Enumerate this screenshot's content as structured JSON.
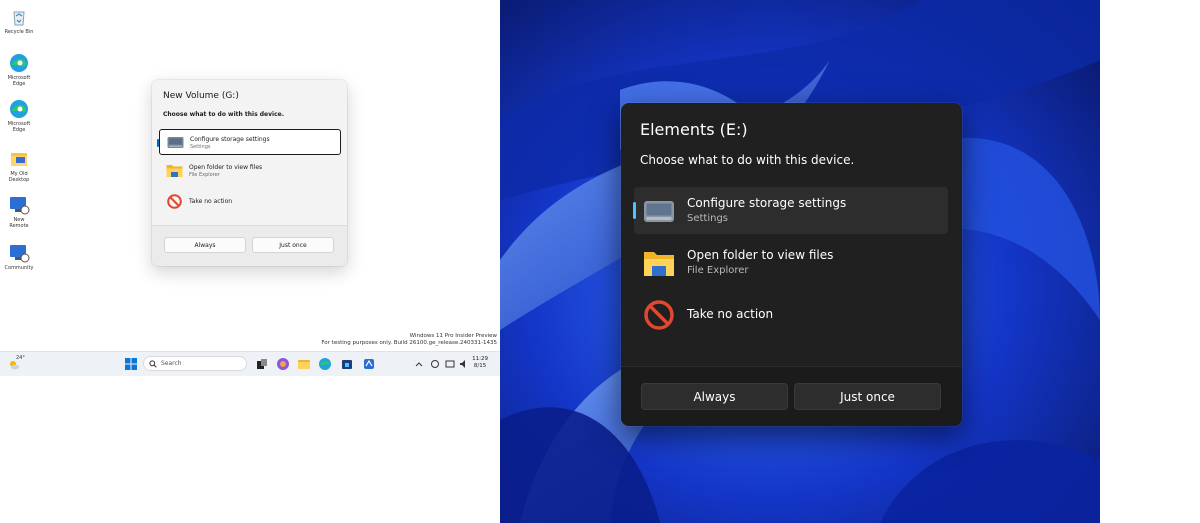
{
  "desktop": {
    "icons": [
      {
        "label": "Recycle Bin",
        "icon": "recycle-bin-icon"
      },
      {
        "label": "Microsoft Edge",
        "icon": "edge-icon"
      },
      {
        "label": "Microsoft Edge",
        "icon": "edge-icon"
      },
      {
        "label": "My Old Desktop",
        "icon": "folder-icon"
      },
      {
        "label": "New Remote",
        "icon": "monitor-icon"
      },
      {
        "label": "Community",
        "icon": "monitor-icon"
      }
    ],
    "watermark": {
      "line1": "Windows 11 Pro Insider Preview",
      "line2": "For testing purposes only. Build 26100.ge_release.240331-1435"
    }
  },
  "left_dialog": {
    "title": "New Volume (G:)",
    "subtitle": "Choose what to do with this device.",
    "options": [
      {
        "title": "Configure storage settings",
        "subtitle": "Settings"
      },
      {
        "title": "Open folder to view files",
        "subtitle": "File Explorer"
      },
      {
        "title": "Take no action"
      }
    ],
    "buttons": {
      "always": "Always",
      "just_once": "Just once"
    }
  },
  "taskbar": {
    "weather": "24°",
    "search_placeholder": "Search",
    "time": "11:29",
    "date": "8/15"
  },
  "right_dialog": {
    "title": "Elements (E:)",
    "subtitle": "Choose what to do with this device.",
    "options": [
      {
        "title": "Configure storage settings",
        "subtitle": "Settings"
      },
      {
        "title": "Open folder to view files",
        "subtitle": "File Explorer"
      },
      {
        "title": "Take no action"
      }
    ],
    "buttons": {
      "always": "Always",
      "just_once": "Just once"
    }
  },
  "colors": {
    "accent_light": "#0067c0",
    "accent_dark": "#4cc2ff",
    "wallpaper_blue": "#1a3cff"
  }
}
